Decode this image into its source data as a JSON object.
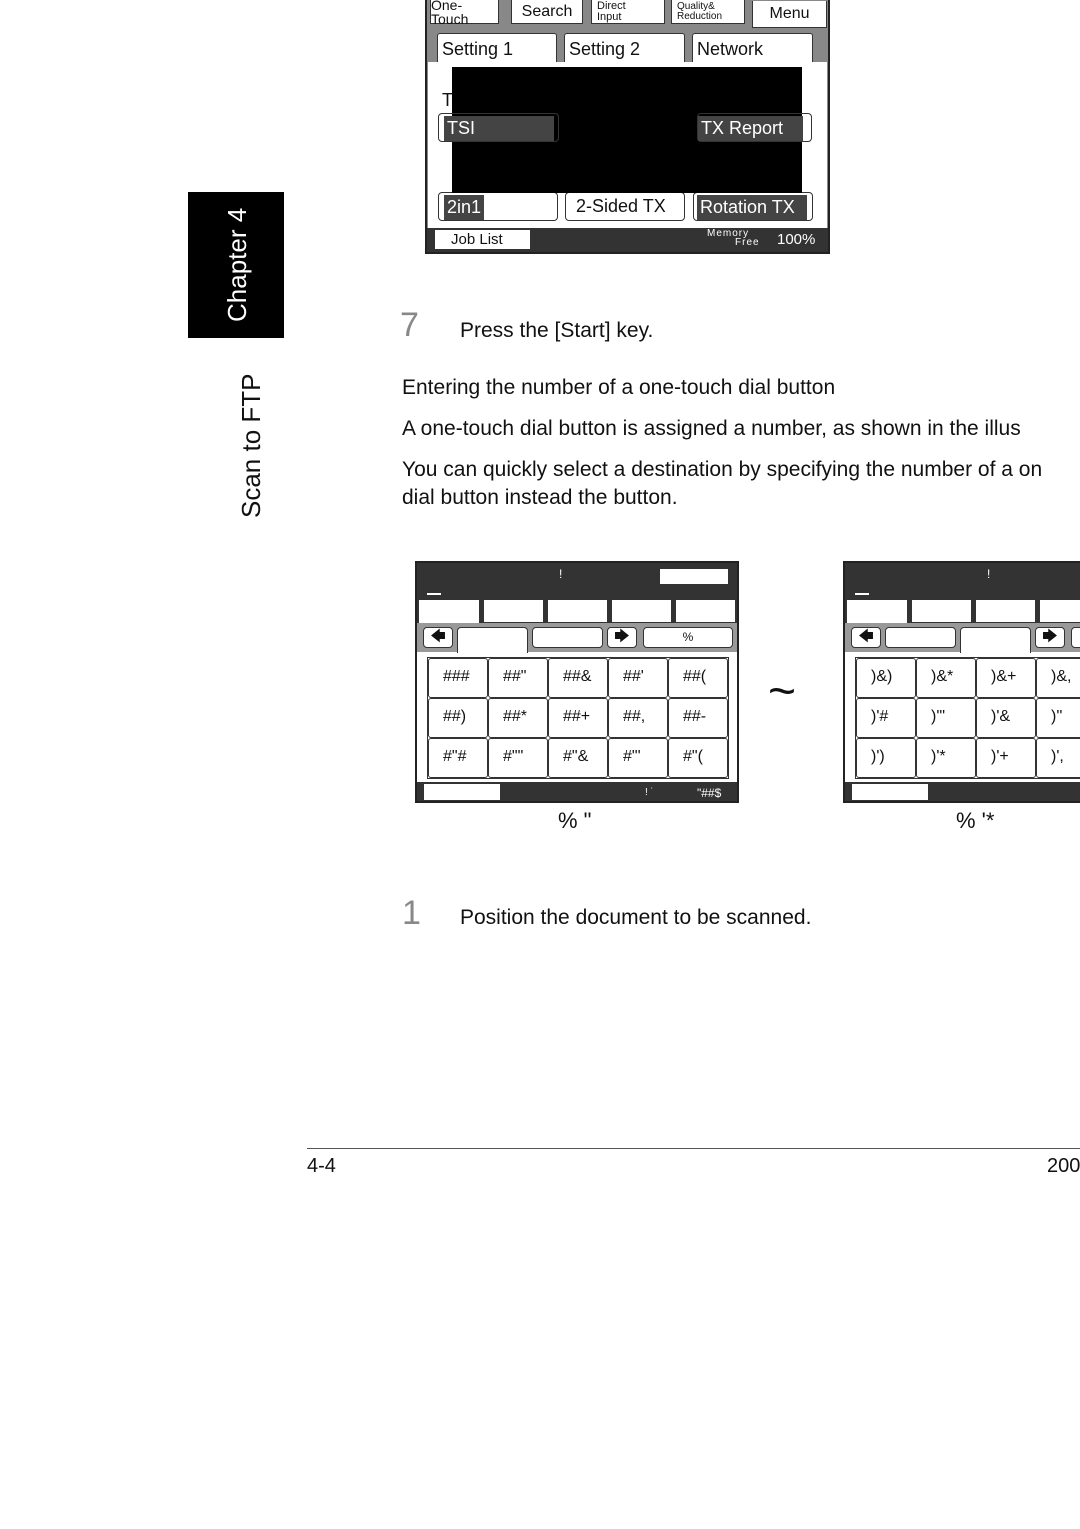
{
  "top_screen": {
    "tabs": [
      "One-Touch",
      "Search",
      "Direct Input",
      "Quality& Reduction",
      "Menu"
    ],
    "direct": [
      "Direct",
      "Input"
    ],
    "quality": [
      "Quality&",
      "Reduction"
    ],
    "subtabs": [
      "Setting 1",
      "Setting 2",
      "Network"
    ],
    "partial_label": "T",
    "tsi": "TSI",
    "tx_report": "TX Report",
    "two_in_one": "2in1",
    "two_sided": "2-Sided TX",
    "rotation": "Rotation TX",
    "job_list": "Job List",
    "memory": "Memory",
    "free": "Free",
    "memory_value": "100%"
  },
  "sidebar": {
    "chapter": "Chapter 4",
    "section": "Scan to FTP"
  },
  "step7": {
    "number": "7",
    "text": "Press the [Start] key."
  },
  "heading": "Entering the number of a one-touch dial button",
  "para1": "A one-touch dial button is assigned a number, as shown in the illus",
  "para2_line1": "You can quickly select a destination by specifying the number of a on",
  "para2_line2": "dial button instead the button.",
  "panel1": {
    "header_mark": "!",
    "tab_button": "%",
    "status_mark": "! ˙",
    "status_value": "\"##$",
    "caption": "% \"",
    "cells": [
      "###",
      "##\"",
      "##&",
      "##'",
      "##(",
      "##)",
      "##*",
      "##+",
      "##,",
      "##-",
      "#\"#",
      "#\"\"",
      "#\"&",
      "#\"'",
      "#\"("
    ]
  },
  "separator": "~",
  "panel2": {
    "header_mark": "!",
    "caption": "% '*",
    "cells": [
      ")&)",
      ")&*",
      ")&+",
      ")&,",
      "",
      ")'#",
      ")'\"",
      ")'&",
      ")''",
      ")'(",
      ")')",
      ")'*",
      ")'+",
      ")',",
      ")'"
    ]
  },
  "step1": {
    "number": "1",
    "text": "Position the document to be scanned."
  },
  "footer": {
    "page": "4-4",
    "right": "200"
  }
}
